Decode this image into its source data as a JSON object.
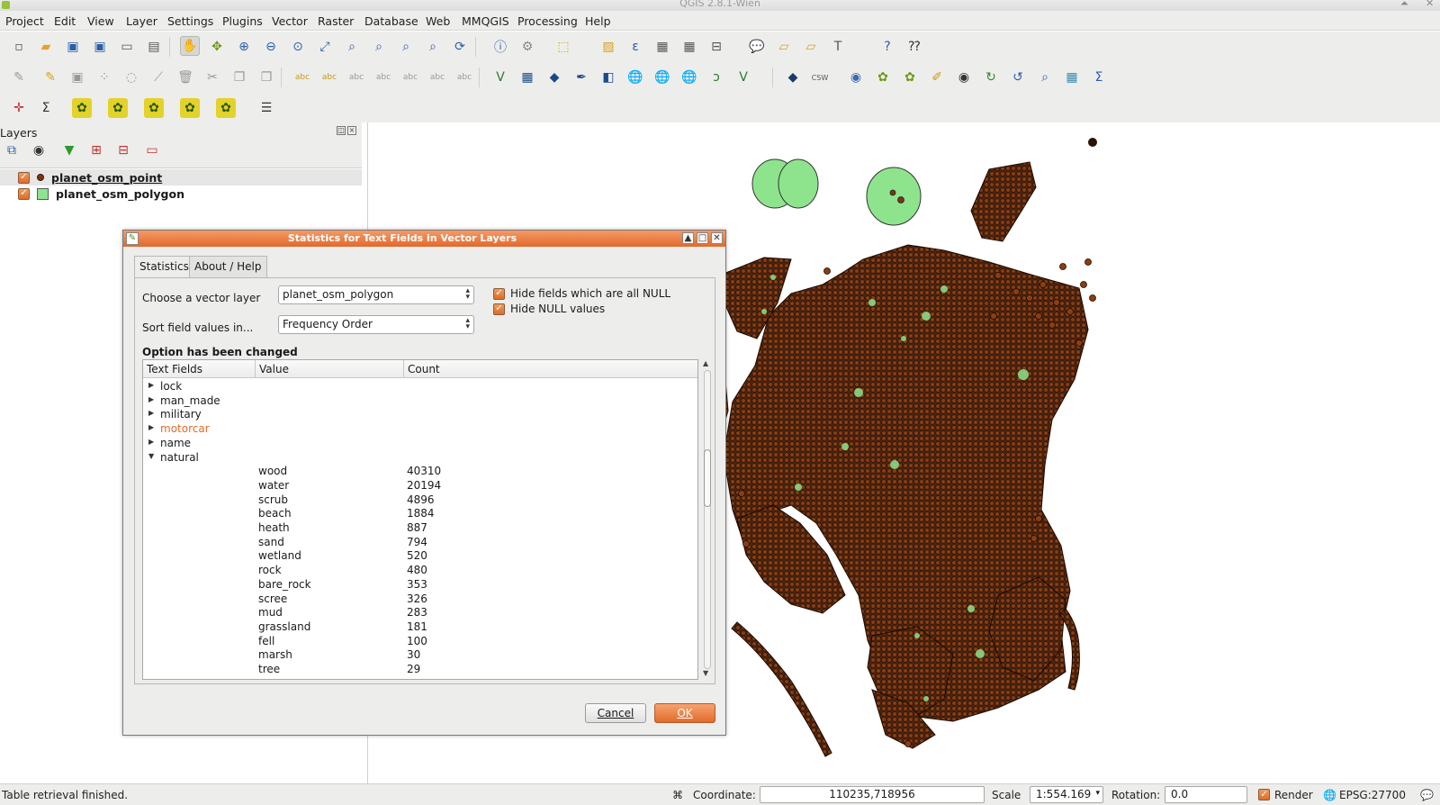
{
  "window": {
    "title": "QGIS 2.8.1-Wien",
    "controls": [
      "⏶",
      "✕"
    ]
  },
  "menu": [
    "Project",
    "Edit",
    "View",
    "Layer",
    "Settings",
    "Plugins",
    "Vector",
    "Raster",
    "Database",
    "Web",
    "MMQGIS",
    "Processing",
    "Help"
  ],
  "layers_panel": {
    "title": "Layers",
    "layers": [
      {
        "name": "planet_osm_point",
        "symbol": "point",
        "checked": true,
        "selected": true
      },
      {
        "name": "planet_osm_polygon",
        "symbol": "polygon",
        "checked": true,
        "selected": false
      }
    ]
  },
  "dialog": {
    "title": "Statistics for Text Fields in Vector Layers",
    "tabs": [
      "Statistics",
      "About / Help"
    ],
    "layer_label": "Choose a vector layer",
    "layer_value": "planet_osm_polygon",
    "sort_label": "Sort field values in...",
    "sort_value": "Frequency Order",
    "hide_null_fields": "Hide fields which are all NULL",
    "hide_null_values": "Hide NULL values",
    "status": "Option has been changed",
    "columns": [
      "Text Fields",
      "Value",
      "Count"
    ],
    "fields": [
      {
        "name": "lock",
        "expanded": false,
        "highlight": false
      },
      {
        "name": "man_made",
        "expanded": false,
        "highlight": false
      },
      {
        "name": "military",
        "expanded": false,
        "highlight": false
      },
      {
        "name": "motorcar",
        "expanded": false,
        "highlight": true
      },
      {
        "name": "name",
        "expanded": false,
        "highlight": false
      },
      {
        "name": "natural",
        "expanded": true,
        "highlight": false
      }
    ],
    "natural_values": [
      {
        "value": "wood",
        "count": "40310"
      },
      {
        "value": "water",
        "count": "20194"
      },
      {
        "value": "scrub",
        "count": "4896"
      },
      {
        "value": "beach",
        "count": "1884"
      },
      {
        "value": "heath",
        "count": "887"
      },
      {
        "value": "sand",
        "count": "794"
      },
      {
        "value": "wetland",
        "count": "520"
      },
      {
        "value": "rock",
        "count": "480"
      },
      {
        "value": "bare_rock",
        "count": "353"
      },
      {
        "value": "scree",
        "count": "326"
      },
      {
        "value": "mud",
        "count": "283"
      },
      {
        "value": "grassland",
        "count": "181"
      },
      {
        "value": "fell",
        "count": "100"
      },
      {
        "value": "marsh",
        "count": "30"
      },
      {
        "value": "tree",
        "count": "29"
      }
    ],
    "cancel": "Cancel",
    "ok": "OK"
  },
  "statusbar": {
    "message": "Table retrieval finished.",
    "coordinate_label": "Coordinate:",
    "coordinate": "110235,718956",
    "scale_label": "Scale",
    "scale": "1:554.169",
    "rotation_label": "Rotation:",
    "rotation": "0.0",
    "render_label": "Render",
    "crs": "EPSG:27700"
  },
  "colors": {
    "accent": "#e2692c",
    "point_fill": "#7a3510",
    "polygon_fill": "#8de48d"
  }
}
